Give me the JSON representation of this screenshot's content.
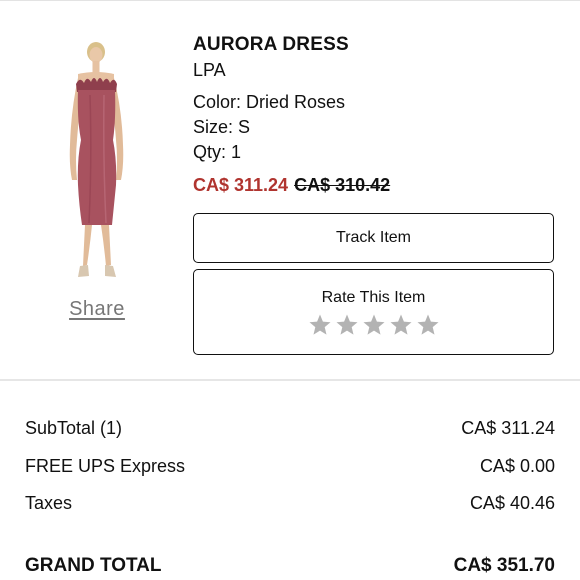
{
  "item": {
    "name": "AURORA DRESS",
    "brand": "LPA",
    "color": "Color: Dried Roses",
    "size": "Size: S",
    "qty": "Qty: 1",
    "sale_price": "CA$ 311.24",
    "original_price": "CA$ 310.42",
    "share_label": "Share",
    "image_icon": "dress-product-photo"
  },
  "actions": {
    "track_label": "Track Item",
    "rate_label": "Rate This Item",
    "rating": {
      "value": 0,
      "max": 5
    }
  },
  "summary": {
    "rows": [
      {
        "label": "SubTotal (1)",
        "value": "CA$ 311.24"
      },
      {
        "label": "FREE UPS Express",
        "value": "CA$ 0.00"
      },
      {
        "label": "Taxes",
        "value": "CA$ 40.46"
      }
    ],
    "grand_total_label": "GRAND TOTAL",
    "grand_total_value": "CA$ 351.70"
  },
  "colors": {
    "sale_price": "#b0342f",
    "dress": "#a8525f",
    "star_empty": "#b3b3b3"
  }
}
